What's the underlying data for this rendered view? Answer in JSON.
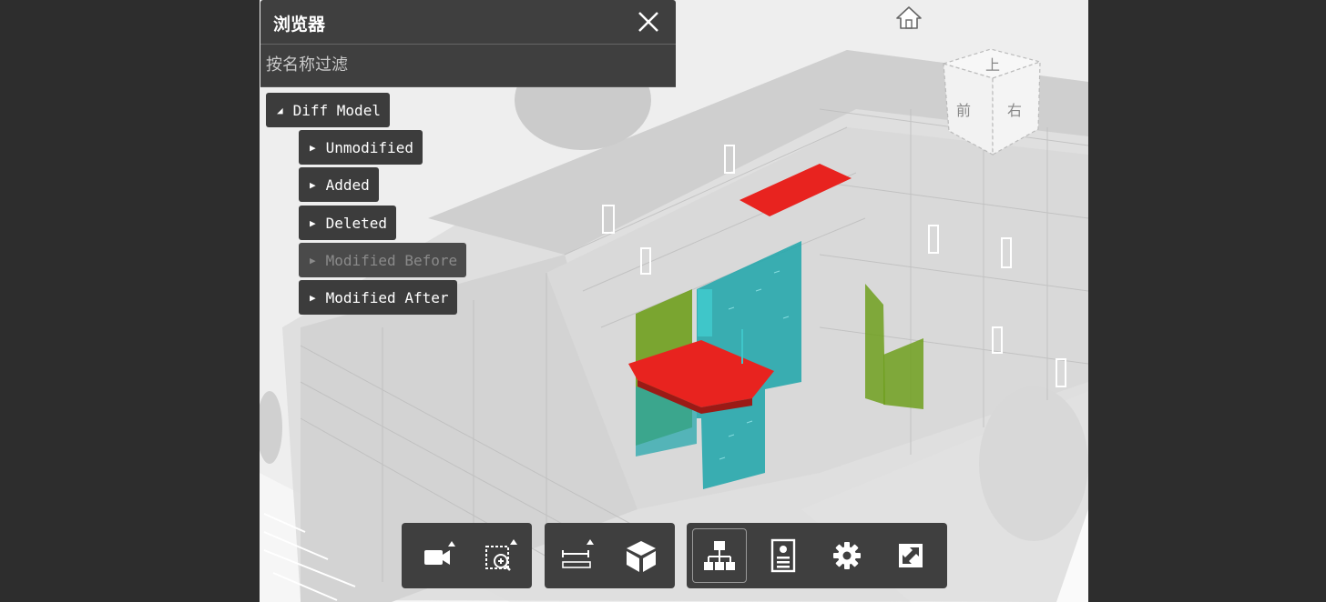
{
  "browser": {
    "title": "浏览器",
    "filter_placeholder": "按名称过滤",
    "tree": {
      "root": {
        "label": "Diff Model",
        "expanded": true
      },
      "children": [
        {
          "label": "Unmodified",
          "disabled": false
        },
        {
          "label": "Added",
          "disabled": false
        },
        {
          "label": "Deleted",
          "disabled": false
        },
        {
          "label": "Modified Before",
          "disabled": true
        },
        {
          "label": "Modified After",
          "disabled": false
        }
      ]
    }
  },
  "view_cube": {
    "top": "上",
    "front": "前",
    "right": "右"
  },
  "toolbar": {
    "groups": [
      [
        "camera-icon",
        "zoom-region-icon"
      ],
      [
        "measure-icon",
        "section-box-icon"
      ],
      [
        "model-browser-icon",
        "properties-icon",
        "settings-icon",
        "fullscreen-icon"
      ]
    ],
    "active": "model-browser-icon"
  },
  "colors": {
    "added": "#27a7ac",
    "deleted": "#e8231f",
    "modified": "#6f9f1d",
    "panel": "#3f3f3f",
    "background": "#2d2d2d"
  }
}
